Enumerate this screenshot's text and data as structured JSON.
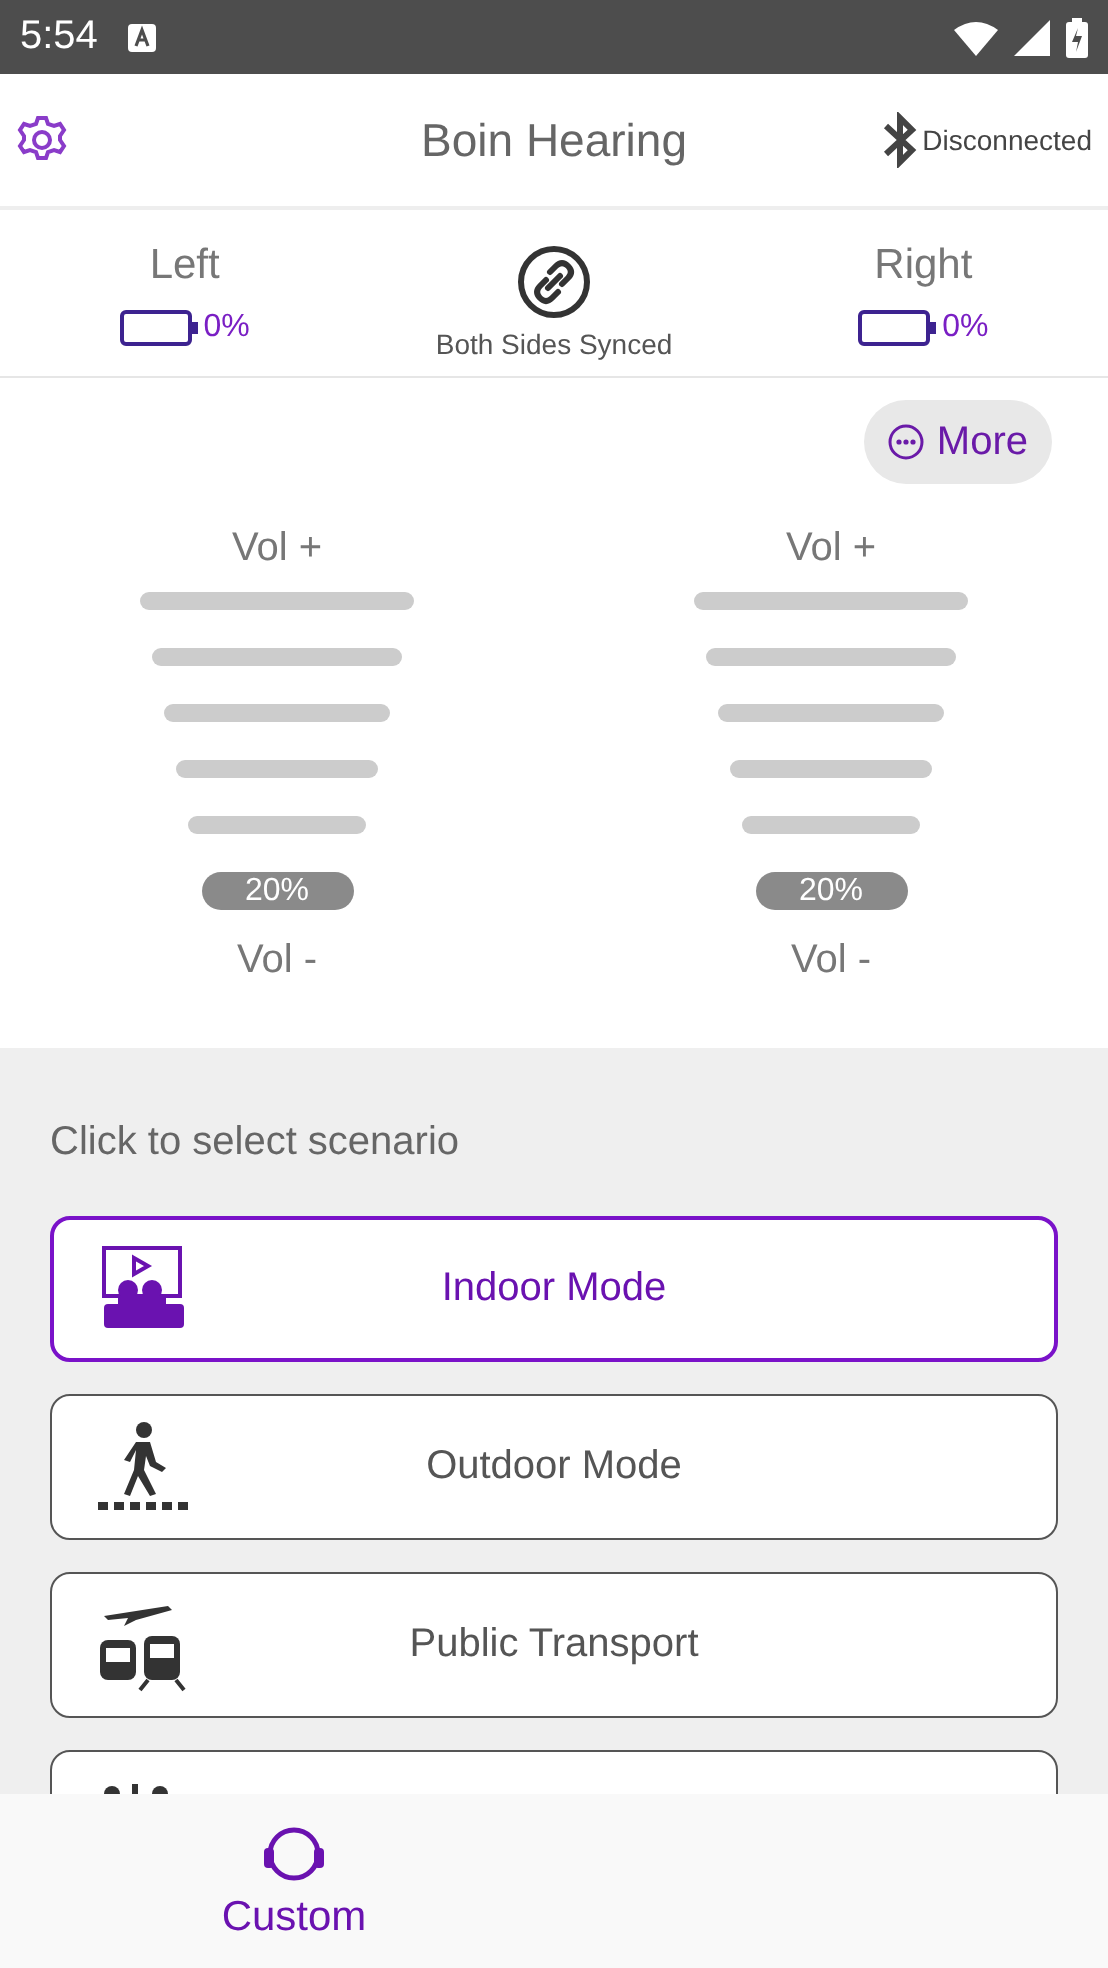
{
  "status_bar": {
    "time": "5:54"
  },
  "app_bar": {
    "title": "Boin Hearing",
    "connection": "Disconnected"
  },
  "sides": [
    {
      "label": "Left",
      "reading": "0%"
    },
    {
      "label": "Right",
      "reading": "0%"
    }
  ],
  "sync": {
    "label": "Both Sides Synced"
  },
  "more_button": {
    "label": "More"
  },
  "volumes": [
    {
      "up": "Vol +",
      "down": "Vol -",
      "reading": "20%"
    },
    {
      "up": "Vol +",
      "down": "Vol -",
      "reading": "20%"
    }
  ],
  "scenario_prompt": "Click to select scenario",
  "scenarios": [
    {
      "kind": "indoor",
      "label": "Indoor Mode",
      "selected": true
    },
    {
      "kind": "outdoor",
      "label": "Outdoor Mode",
      "selected": false
    },
    {
      "kind": "transport",
      "label": "Public Transport",
      "selected": false
    },
    {
      "kind": "other",
      "selected": false
    }
  ],
  "bottom_nav": [
    {
      "label": "Custom",
      "selected": true
    }
  ]
}
